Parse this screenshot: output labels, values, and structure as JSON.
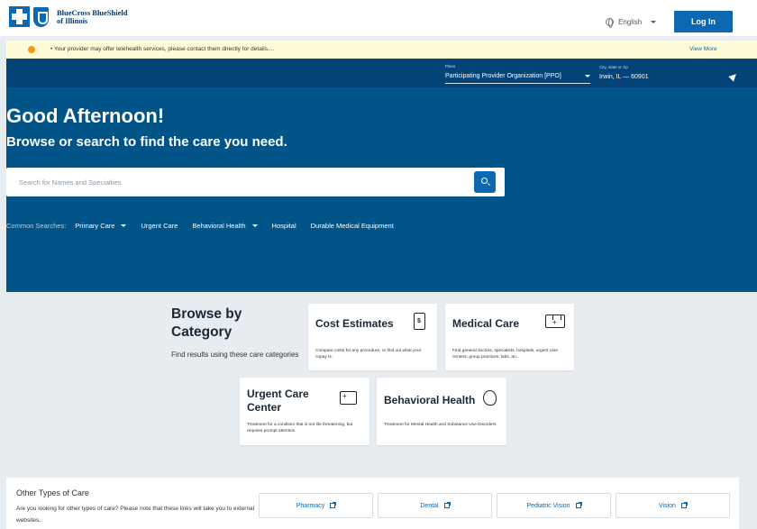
{
  "header": {
    "brand_line1": "BlueCross BlueShield",
    "brand_line2": "of Illinois",
    "language": "English",
    "login_label": "Log In"
  },
  "alert": {
    "text": "• Your provider may offer telehealth services, please contact them directly for details....",
    "view_more": "View More",
    "accent_color": "#f29b13"
  },
  "plan": {
    "label": "Plans",
    "value": "Participating Provider Organization [PPO]"
  },
  "location": {
    "label": "City, state or zip",
    "value": "Irwin, IL — 60901"
  },
  "hero": {
    "greeting": "Good Afternoon!",
    "subheading": "Browse or search to find the care you need.",
    "search_placeholder": "Search for Names and Specialties",
    "bg_color": "#005487"
  },
  "common_searches": {
    "label": "Common Searches:",
    "items": [
      "Primary Care",
      "Urgent Care",
      "Behavioral Health",
      "Hospital",
      "Durable Medical Equipment"
    ]
  },
  "browse": {
    "title_line1": "Browse by",
    "title_line2": "Category",
    "subtitle": "Find results using these care categories",
    "cards": [
      {
        "title": "Cost Estimates",
        "desc": "Compare costs for any procedure, or find out what your copay is.",
        "icon": "receipt-dollar-icon"
      },
      {
        "title": "Medical Care",
        "desc": "Find general doctors, specialists, hospitals, urgent care centers, group practices, labs, an...",
        "icon": "hospital-building-icon"
      },
      {
        "title_line1": "Urgent Care",
        "title_line2": "Center",
        "desc": "Treatment for a condition that is not life threatening, but requires prompt attention",
        "icon": "ambulance-icon"
      },
      {
        "title": "Behavioral Health",
        "desc": "Treatment for Mental Health and Substance Use Disorders",
        "icon": "head-brain-icon"
      }
    ]
  },
  "other_care": {
    "title": "Other Types of Care",
    "desc": "Are you looking for other types of care? Please note that these links will take you to external websites.",
    "links": [
      "Pharmacy",
      "Dental",
      "Pediatric Vision",
      "Vision"
    ]
  },
  "brand_color": "#0b68b1"
}
